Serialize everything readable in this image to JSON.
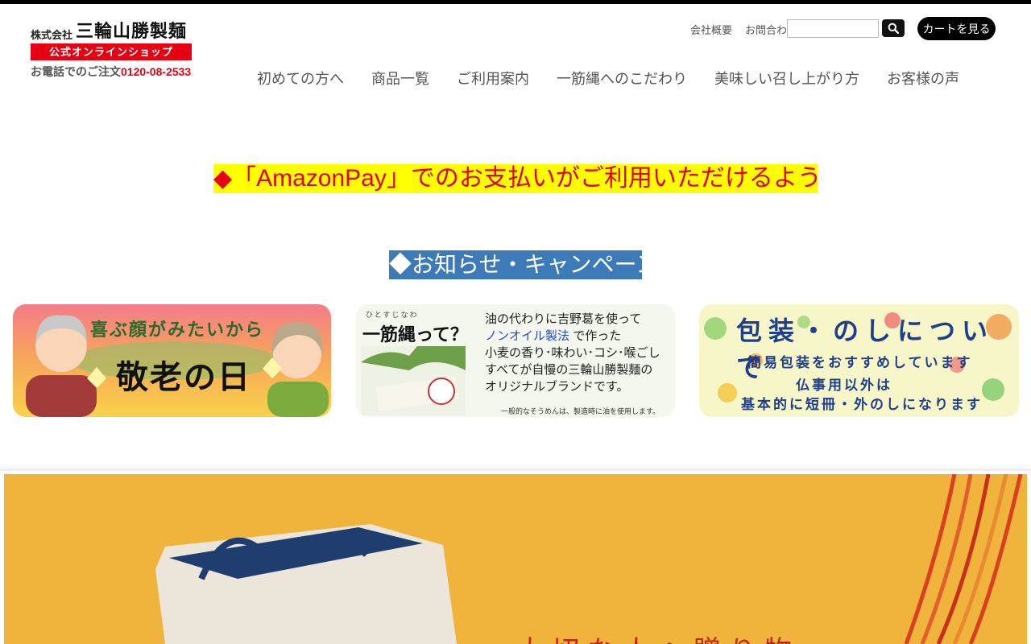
{
  "header": {
    "logo": {
      "kabu": "株式会社",
      "name": "三輪山勝製麺",
      "shop_label": "公式オンラインショップ",
      "phone_label": "お電話でのご注文",
      "phone_number": "0120-08-2533"
    },
    "util_links": [
      "会社概要",
      "お問合わせ"
    ],
    "search": {
      "placeholder": ""
    },
    "cart_label": "カートを見る",
    "nav": [
      "初めての方へ",
      "商品一覧",
      "ご利用案内",
      "一筋縄へのこだわり",
      "美味しい召し上がり方",
      "お客様の声"
    ]
  },
  "notices": {
    "amazon": "◆「AmazonPay」でのお支払いがご利用いただけるようになりました◆",
    "info": "◆お知らせ・キャンペーン情報◆"
  },
  "banners": [
    {
      "line1": "喜ぶ顔がみたいから",
      "line2": "敬老の日"
    },
    {
      "ruby": "ひとすじなわ",
      "title": "一筋縄って？",
      "lines": [
        "油の代わりに吉野葛を使って",
        "で作った",
        "小麦の香り･味わい･コシ･喉ごし",
        "すべてが自慢の三輪山勝製麺の",
        "オリジナルブランドです。"
      ],
      "highlight": "ノンオイル製法",
      "footnote": "一般的なそうめんは、製造時に油を使用します。"
    },
    {
      "title": "包装・のしについて",
      "line1": "簡易包装をおすすめしています",
      "line2": "仏事用以外は",
      "line3": "基本的に短冊・外のしになります"
    }
  ],
  "hero": {
    "text": "大切な人へ贈り物"
  },
  "colors": {
    "accent_red": "#e60012",
    "notice_yellow": "#ffff00",
    "info_blue": "#3d7ab8",
    "hero_orange": "#f0b43d"
  }
}
